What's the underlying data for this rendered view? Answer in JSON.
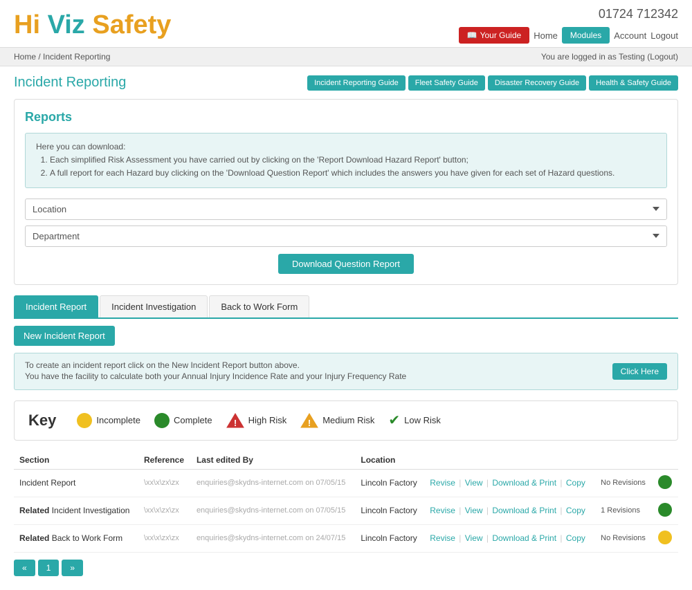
{
  "header": {
    "logo_hi": "Hi",
    "logo_viz": "Viz",
    "logo_safety": "Safety",
    "phone": "01724 712342",
    "your_guide_label": "Your Guide",
    "home_label": "Home",
    "modules_label": "Modules",
    "account_label": "Account",
    "logout_label": "Logout"
  },
  "breadcrumb": {
    "home": "Home",
    "separator1": "/",
    "current": "Incident Reporting",
    "logged_in_text": "You are logged in as Testing (Logout)"
  },
  "page": {
    "title": "Incident Reporting",
    "guides": [
      {
        "label": "Incident Reporting Guide"
      },
      {
        "label": "Fleet Safety Guide"
      },
      {
        "label": "Disaster Recovery Guide"
      },
      {
        "label": "Health & Safety Guide"
      }
    ]
  },
  "reports": {
    "title": "Reports",
    "info_line1": "Here you can download:",
    "info_item1": "Each simplified Risk Assessment you have carried out by clicking on the 'Report Download Hazard Report' button;",
    "info_item2": "A full report for each Hazard buy clicking on the 'Download Question Report' which includes the answers you have given for each set of Hazard questions.",
    "location_placeholder": "Location",
    "department_placeholder": "Department",
    "download_btn": "Download Question Report"
  },
  "tabs": [
    {
      "label": "Incident Report",
      "active": true
    },
    {
      "label": "Incident Investigation",
      "active": false
    },
    {
      "label": "Back to Work Form",
      "active": false
    }
  ],
  "incident": {
    "new_btn": "New Incident Report",
    "info_line1": "To create an incident report click on the New Incident Report button above.",
    "info_line2": "You have the facility to calculate both your Annual Injury Incidence Rate and your Injury Frequency Rate",
    "click_here_btn": "Click Here"
  },
  "key": {
    "title": "Key",
    "items": [
      {
        "type": "circle-yellow",
        "label": "Incomplete"
      },
      {
        "type": "circle-green",
        "label": "Complete"
      },
      {
        "type": "triangle-red",
        "label": "High Risk"
      },
      {
        "type": "triangle-yellow",
        "label": "Medium Risk"
      },
      {
        "type": "checkmark",
        "label": "Low Risk"
      }
    ]
  },
  "table": {
    "columns": [
      "Section",
      "Reference",
      "Last edited By",
      "Location",
      "",
      "",
      ""
    ],
    "rows": [
      {
        "section": "Incident Report",
        "reference": "\\xx\\x\\zx\\zx",
        "edited_by": "enquiries@skydns-internet.com on 07/05/15",
        "location": "Lincoln Factory",
        "actions": "Revise | View | Download & Print | Copy",
        "revisions": "No Revisions",
        "status": "green"
      },
      {
        "section_bold": "Related",
        "section_rest": " Incident Investigation",
        "reference": "\\xx\\x\\zx\\zx",
        "edited_by": "enquiries@skydns-internet.com on 07/05/15",
        "location": "Lincoln Factory",
        "actions": "Revise | View | Download & Print | Copy",
        "revisions": "1 Revisions",
        "status": "green"
      },
      {
        "section_bold": "Related",
        "section_rest": " Back to Work Form",
        "reference": "\\xx\\x\\zx\\zx",
        "edited_by": "enquiries@skydns-internet.com on 24/07/15",
        "location": "Lincoln Factory",
        "actions": "Revise | View | Download & Print | Copy",
        "revisions": "No Revisions",
        "status": "yellow"
      }
    ]
  },
  "pagination": {
    "btn1": "«",
    "btn2": "1",
    "btn3": "»"
  }
}
